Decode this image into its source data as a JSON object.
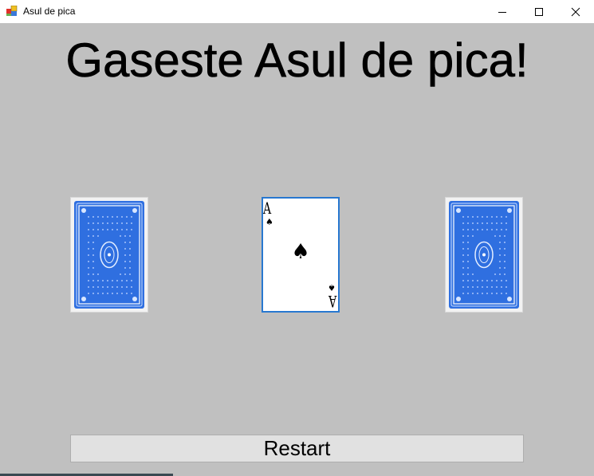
{
  "window": {
    "title": "Asul de pica",
    "icon": "winforms-app-icon",
    "controls": [
      "minimize-icon",
      "maximize-icon",
      "close-icon"
    ]
  },
  "game": {
    "heading": "Gaseste Asul de pica!",
    "cards": [
      {
        "state": "face-down",
        "back_color": "#2f6fe0"
      },
      {
        "state": "face-up",
        "rank": "A",
        "suit": "♠",
        "selected": true
      },
      {
        "state": "face-down",
        "back_color": "#2f6fe0"
      }
    ],
    "restart_label": "Restart"
  },
  "colors": {
    "client_background": "#c0c0c0",
    "card_back_blue": "#2f6fe0",
    "selection_border": "#2878d0",
    "button_face": "#e1e1e1"
  }
}
